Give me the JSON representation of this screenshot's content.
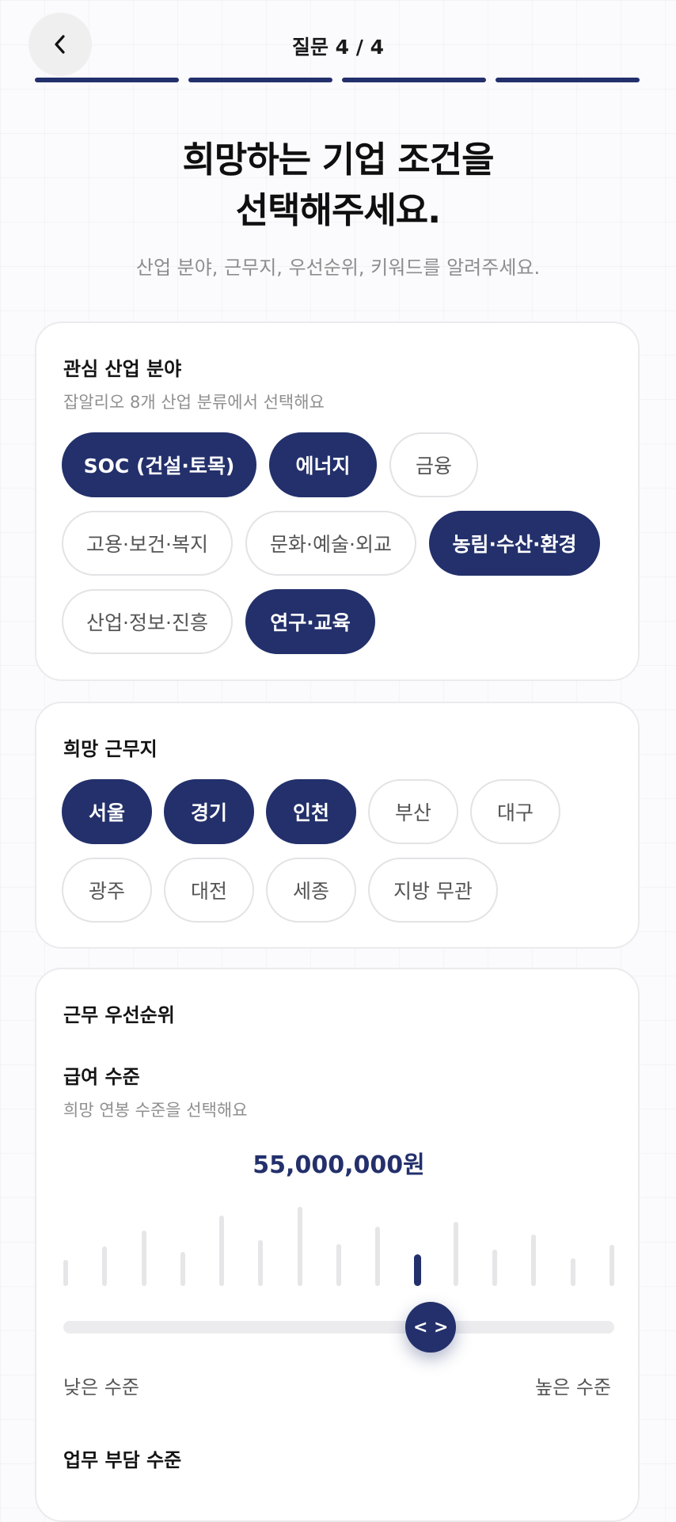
{
  "header": {
    "step_label": "질문 4 / 4",
    "progress_total": 4,
    "progress_done": 4,
    "accent_color": "#23306b"
  },
  "intro": {
    "title_line1": "희망하는 기업 조건을",
    "title_line2": "선택해주세요.",
    "subtitle": "산업 분야, 근무지, 우선순위, 키워드를 알려주세요."
  },
  "industry": {
    "title": "관심 산업 분야",
    "description": "잡알리오 8개 산업 분류에서 선택해요",
    "chips": [
      {
        "label": "SOC (건설·토목)",
        "selected": true
      },
      {
        "label": "에너지",
        "selected": true
      },
      {
        "label": "금융",
        "selected": false
      },
      {
        "label": "고용·보건·복지",
        "selected": false
      },
      {
        "label": "문화·예술·외교",
        "selected": false
      },
      {
        "label": "농림·수산·환경",
        "selected": true
      },
      {
        "label": "산업·정보·진흥",
        "selected": false
      },
      {
        "label": "연구·교육",
        "selected": true
      }
    ]
  },
  "location": {
    "title": "희망 근무지",
    "chips": [
      {
        "label": "서울",
        "selected": true
      },
      {
        "label": "경기",
        "selected": true
      },
      {
        "label": "인천",
        "selected": true
      },
      {
        "label": "부산",
        "selected": false
      },
      {
        "label": "대구",
        "selected": false
      },
      {
        "label": "광주",
        "selected": false
      },
      {
        "label": "대전",
        "selected": false
      },
      {
        "label": "세종",
        "selected": false
      },
      {
        "label": "지방 무관",
        "selected": false
      }
    ]
  },
  "priority": {
    "title": "근무 우선순위",
    "salary": {
      "title": "급여 수준",
      "description": "희망 연봉 수준을 선택해요",
      "value_text": "55,000,000원",
      "slider_fraction": 0.667,
      "distribution": [
        0.33,
        0.5,
        0.7,
        0.43,
        0.89,
        0.58,
        1.0,
        0.53,
        0.75,
        0.37,
        0.81,
        0.46,
        0.65,
        0.35,
        0.52
      ],
      "active_index": 9,
      "thumb_glyph": "< >",
      "low_label": "낮은 수준",
      "high_label": "높은 수준"
    },
    "workload": {
      "title": "업무 부담 수준"
    }
  }
}
